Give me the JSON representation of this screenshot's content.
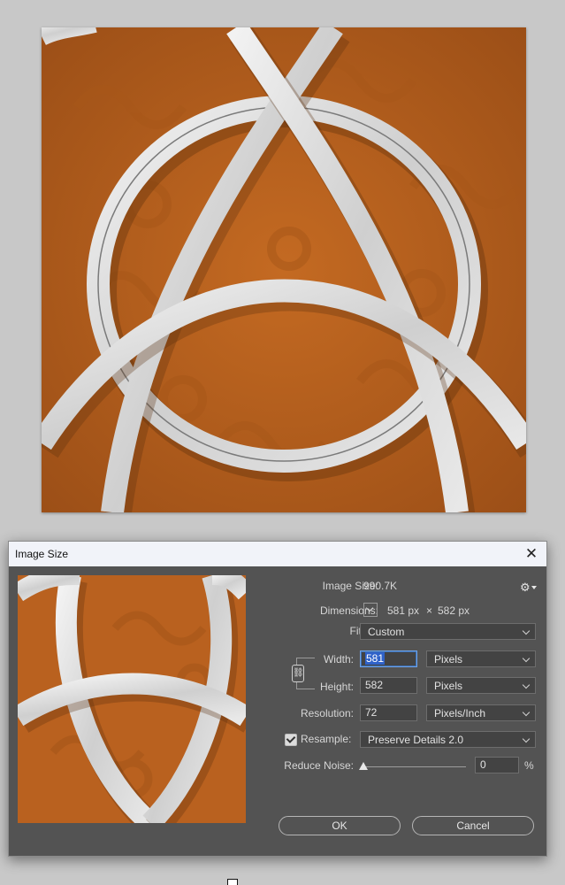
{
  "dialog": {
    "title": "Image Size",
    "close_glyph": "✕",
    "image_size_label": "Image Size:",
    "image_size_value": "990.7K",
    "settings_icon": "gear-icon",
    "settings_glyph": "⚙",
    "dimensions_label": "Dimensions:",
    "dimensions_width": "581 px",
    "dimensions_times": "×",
    "dimensions_height": "582 px",
    "fit_to_label": "Fit To:",
    "fit_to_value": "Custom",
    "width_label": "Width:",
    "width_value": "581",
    "width_unit": "Pixels",
    "height_label": "Height:",
    "height_value": "582",
    "height_unit": "Pixels",
    "constrain_icon": "chain-link-icon",
    "constrain_glyph": "⛓",
    "resolution_label": "Resolution:",
    "resolution_value": "72",
    "resolution_unit": "Pixels/Inch",
    "resample_label": "Resample:",
    "resample_checked": true,
    "resample_value": "Preserve Details 2.0",
    "reduce_noise_label": "Reduce Noise:",
    "reduce_noise_value": "0",
    "reduce_noise_percent": "%",
    "reduce_noise_fraction": 0,
    "ok_label": "OK",
    "cancel_label": "Cancel"
  },
  "colors": {
    "canvas_background": "#b7601e",
    "dialog_background": "#535353",
    "titlebar": "#f1f3f9",
    "ring_silver": "#d9d9d9",
    "selection_highlight": "#2f62c9"
  }
}
